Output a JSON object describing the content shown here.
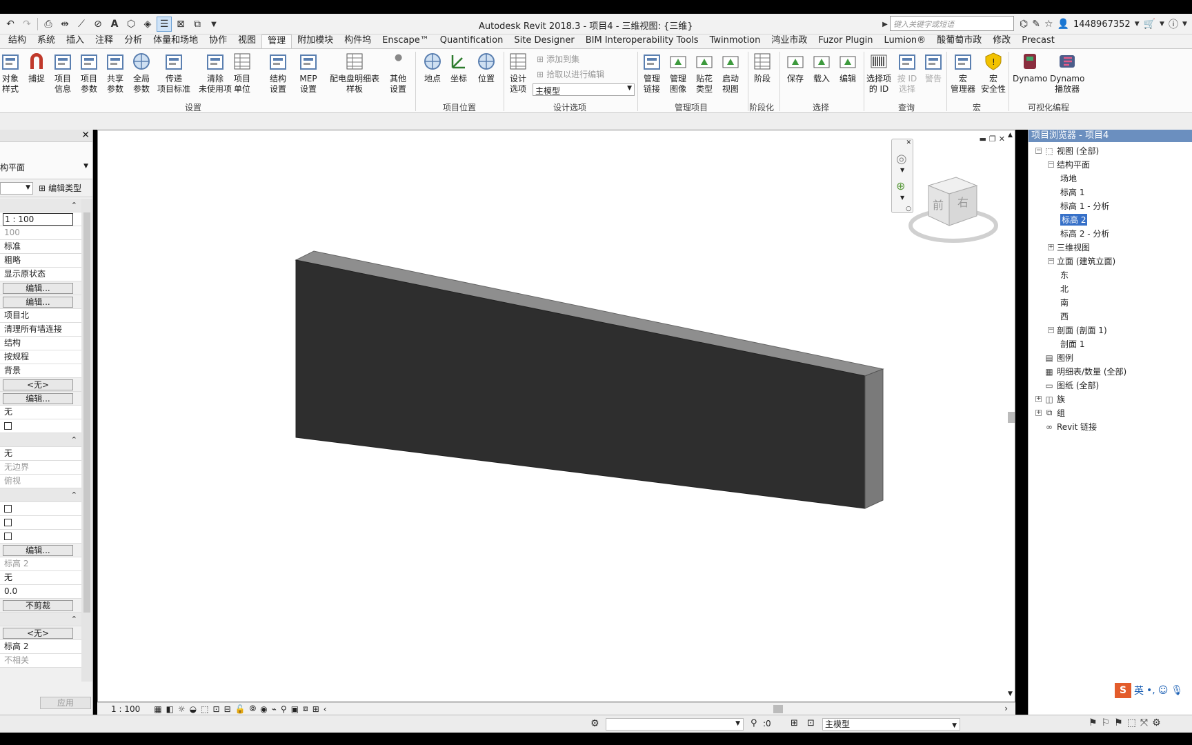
{
  "window": {
    "title": "Autodesk Revit 2018.3 -      项目4 - 三维视图: {三维}",
    "search_placeholder": "键入关键字或短语",
    "user": "1448967352"
  },
  "tabs": [
    "结构",
    "系统",
    "插入",
    "注释",
    "分析",
    "体量和场地",
    "协作",
    "视图",
    "管理",
    "附加模块",
    "构件坞",
    "Enscape™",
    "Quantification",
    "Site Designer",
    "BIM Interoperability Tools",
    "Twinmotion",
    "鸿业市政",
    "Fuzor Plugin",
    "Lumion®",
    "酸葡萄市政",
    "修改",
    "Precast"
  ],
  "active_tab": "管理",
  "ribbon": {
    "settings": {
      "label": "设置",
      "buttons": [
        "对象\n样式",
        "捕捉",
        "项目\n信息",
        "项目\n参数",
        "共享\n参数",
        "全局\n参数",
        "传递\n项目标准",
        "清除\n未使用项",
        "项目\n单位",
        "结构\n设置",
        "MEP\n设置",
        "配电盘明细表\n样板",
        "其他\n设置"
      ]
    },
    "project_location": {
      "label": "项目位置",
      "buttons": [
        "地点",
        "坐标",
        "位置"
      ]
    },
    "design_options": {
      "label": "设计选项",
      "button": "设计\n选项",
      "small": [
        "添加到集",
        "拾取以进行编辑"
      ],
      "combo": "主模型"
    },
    "manage_project": {
      "label": "管理项目",
      "buttons": [
        "管理\n链接",
        "管理\n图像",
        "贴花\n类型",
        "启动\n视图"
      ]
    },
    "phasing": {
      "label": "阶段化",
      "button": "阶段"
    },
    "selection": {
      "label": "选择",
      "buttons": [
        "保存",
        "载入",
        "编辑"
      ]
    },
    "inquiry": {
      "label": "查询",
      "buttons": [
        "选择项\n的 ID",
        "按 ID\n选择",
        "警告"
      ]
    },
    "macros": {
      "label": "宏",
      "buttons": [
        "宏\n管理器",
        "宏\n安全性"
      ]
    },
    "visual_programming": {
      "label": "可视化编程",
      "buttons": [
        "Dynamo",
        "Dynamo\n播放器"
      ]
    }
  },
  "properties": {
    "type_label": "构平面",
    "edit_type": "编辑类型",
    "rows": [
      {
        "k": "hdr"
      },
      {
        "k": "input",
        "v": "1 : 100"
      },
      {
        "k": "gray",
        "v": "100"
      },
      {
        "k": "text",
        "v": "标准"
      },
      {
        "k": "text",
        "v": "粗略"
      },
      {
        "k": "text",
        "v": "显示原状态"
      },
      {
        "k": "btn",
        "v": "编辑..."
      },
      {
        "k": "btn",
        "v": "编辑..."
      },
      {
        "k": "text",
        "v": "项目北"
      },
      {
        "k": "text",
        "v": "清理所有墙连接"
      },
      {
        "k": "text",
        "v": "结构"
      },
      {
        "k": "text",
        "v": "按规程"
      },
      {
        "k": "text",
        "v": "背景"
      },
      {
        "k": "btn",
        "v": "<无>"
      },
      {
        "k": "btn",
        "v": "编辑..."
      },
      {
        "k": "text",
        "v": "无"
      },
      {
        "k": "check"
      },
      {
        "k": "hdr"
      },
      {
        "k": "text",
        "v": "无"
      },
      {
        "k": "gray",
        "v": "无边界"
      },
      {
        "k": "gray",
        "v": "俯视"
      },
      {
        "k": "hdr"
      },
      {
        "k": "check"
      },
      {
        "k": "check"
      },
      {
        "k": "check"
      },
      {
        "k": "btn",
        "v": "编辑..."
      },
      {
        "k": "gray",
        "v": "标高 2"
      },
      {
        "k": "text",
        "v": "无"
      },
      {
        "k": "text",
        "v": "0.0"
      },
      {
        "k": "btn",
        "v": "不剪裁"
      },
      {
        "k": "hdr"
      },
      {
        "k": "btn",
        "v": "<无>"
      },
      {
        "k": "text",
        "v": "标高 2"
      },
      {
        "k": "gray",
        "v": "不相关"
      }
    ],
    "apply": "应用"
  },
  "viewcube": {
    "front": "前",
    "right": "右"
  },
  "view_bar": {
    "scale": "1 : 100"
  },
  "browser": {
    "title": "项目浏览器 - 项目4",
    "nodes": [
      {
        "t": "视图 (全部)",
        "lvl": 0,
        "tog": "-"
      },
      {
        "t": "结构平面",
        "lvl": 1,
        "tog": "-"
      },
      {
        "t": "场地",
        "lvl": 2
      },
      {
        "t": "标高 1",
        "lvl": 2
      },
      {
        "t": "标高 1 - 分析",
        "lvl": 2
      },
      {
        "t": "标高 2",
        "lvl": 2,
        "sel": true
      },
      {
        "t": "标高 2 - 分析",
        "lvl": 2
      },
      {
        "t": "三维视图",
        "lvl": 1,
        "tog": "+"
      },
      {
        "t": "立面 (建筑立面)",
        "lvl": 1,
        "tog": "-"
      },
      {
        "t": "东",
        "lvl": 2
      },
      {
        "t": "北",
        "lvl": 2
      },
      {
        "t": "南",
        "lvl": 2
      },
      {
        "t": "西",
        "lvl": 2
      },
      {
        "t": "剖面 (剖面 1)",
        "lvl": 1,
        "tog": "-"
      },
      {
        "t": "剖面 1",
        "lvl": 2
      },
      {
        "t": "图例",
        "lvl": 0,
        "icon": "legend-icon"
      },
      {
        "t": "明细表/数量 (全部)",
        "lvl": 0,
        "icon": "schedule-icon"
      },
      {
        "t": "图纸 (全部)",
        "lvl": 0,
        "icon": "sheet-icon"
      },
      {
        "t": "族",
        "lvl": 0,
        "tog": "+",
        "icon": "family-icon"
      },
      {
        "t": "组",
        "lvl": 0,
        "tog": "+",
        "icon": "group-icon"
      },
      {
        "t": "Revit 链接",
        "lvl": 0,
        "icon": "link-icon"
      }
    ]
  },
  "ime": {
    "lang": "英"
  },
  "status": {
    "selection_count": ":0",
    "model": "主模型"
  }
}
